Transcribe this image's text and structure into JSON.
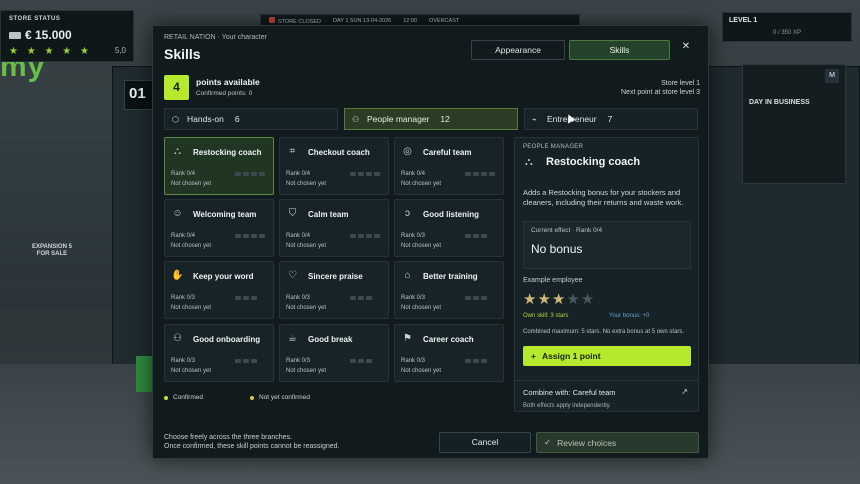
{
  "hud": {
    "store_status_label": "STORE STATUS",
    "money": "€ 15.000",
    "stars": "★ ★ ★ ★ ★",
    "rating": "5,0",
    "store_state": "STORE CLOSED",
    "day": "DAY 1  SUN  13-04-2026",
    "time": "12:00",
    "weather": "OVERCAST",
    "level_label": "LEVEL 1",
    "xp": "0 / 350 XP",
    "day_in_business": "DAY IN BUSINESS",
    "m_key": "M",
    "big_logo": "my",
    "left_counter": "01",
    "expansion": "EXPANSION 5\nFOR SALE"
  },
  "modal": {
    "subtitle": "RETAIL NATION · Your character",
    "title": "Skills",
    "tabs": [
      {
        "label": "Appearance"
      },
      {
        "label": "Skills"
      }
    ],
    "close_glyph": "✕"
  },
  "points": {
    "available": "4",
    "available_label": "points available",
    "confirmed": "Confirmed points: 0",
    "store_level": "Store level 1",
    "next_point": "Next point at store level 3"
  },
  "branches": [
    {
      "label": "Hands-on",
      "count": "6",
      "icon": "box-icon"
    },
    {
      "label": "People manager",
      "count": "12",
      "icon": "people-icon"
    },
    {
      "label": "Entrepreneur",
      "count": "7",
      "icon": "chart-icon"
    }
  ],
  "skills": [
    {
      "name": "Restocking coach",
      "rank": "Rank 0/4",
      "state": "Not chosen yet",
      "icon": "restock-icon",
      "glyph": "⛬"
    },
    {
      "name": "Checkout coach",
      "rank": "Rank 0/4",
      "state": "Not chosen yet",
      "icon": "checkout-icon",
      "glyph": "⌗"
    },
    {
      "name": "Careful team",
      "rank": "Rank 0/4",
      "state": "Not chosen yet",
      "icon": "target-icon",
      "glyph": "◎"
    },
    {
      "name": "Welcoming team",
      "rank": "Rank 0/4",
      "state": "Not chosen yet",
      "icon": "smile-icon",
      "glyph": "☺"
    },
    {
      "name": "Calm team",
      "rank": "Rank 0/4",
      "state": "Not chosen yet",
      "icon": "shield-icon",
      "glyph": "⛉"
    },
    {
      "name": "Good listening",
      "rank": "Rank 0/3",
      "state": "Not chosen yet",
      "icon": "ear-icon",
      "glyph": "ↄ"
    },
    {
      "name": "Keep your word",
      "rank": "Rank 0/3",
      "state": "Not chosen yet",
      "icon": "handshake-icon",
      "glyph": "✋"
    },
    {
      "name": "Sincere praise",
      "rank": "Rank 0/3",
      "state": "Not chosen yet",
      "icon": "heart-icon",
      "glyph": "♡"
    },
    {
      "name": "Better training",
      "rank": "Rank 0/3",
      "state": "Not chosen yet",
      "icon": "graduation-icon",
      "glyph": "⌂"
    },
    {
      "name": "Good onboarding",
      "rank": "Rank 0/3",
      "state": "Not chosen yet",
      "icon": "user-add-icon",
      "glyph": "⚇"
    },
    {
      "name": "Good break",
      "rank": "Rank 0/3",
      "state": "Not chosen yet",
      "icon": "coffee-icon",
      "glyph": "☕"
    },
    {
      "name": "Career coach",
      "rank": "Rank 0/3",
      "state": "Not chosen yet",
      "icon": "signpost-icon",
      "glyph": "⚑"
    }
  ],
  "legend": {
    "confirmed": "Confirmed",
    "not_confirmed": "Not yet confirmed",
    "confirmed_color": "#b6e92d",
    "not_confirmed_color": "#e0c24a"
  },
  "detail": {
    "branch": "PEOPLE MANAGER",
    "name": "Restocking coach",
    "description": "Adds a Restocking bonus for your stockers and cleaners, including their returns and waste work.",
    "effect_label": "Current effect · Rank 0/4",
    "effect_value": "No bonus",
    "example_label": "Example employee",
    "example_stars_filled": 3,
    "example_stars_total": 5,
    "own_skill": "Own skill: 3 stars",
    "your_bonus": "Your bonus: +0",
    "combined": "Combined maximum: 5 stars. No extra bonus at 5 own stars.",
    "assign_label": "Assign 1 point",
    "combine_with": "Combine with: Careful team",
    "both_effects": "Both effects apply independently."
  },
  "footer": {
    "note_line1": "Choose freely across the three branches.",
    "note_line2": "Once confirmed, these skill points cannot be reassigned.",
    "cancel": "Cancel",
    "review": "Review choices"
  },
  "colors": {
    "accent": "#b6e92d",
    "panel": "#111b1e",
    "selected_border": "#5b8a3e"
  }
}
